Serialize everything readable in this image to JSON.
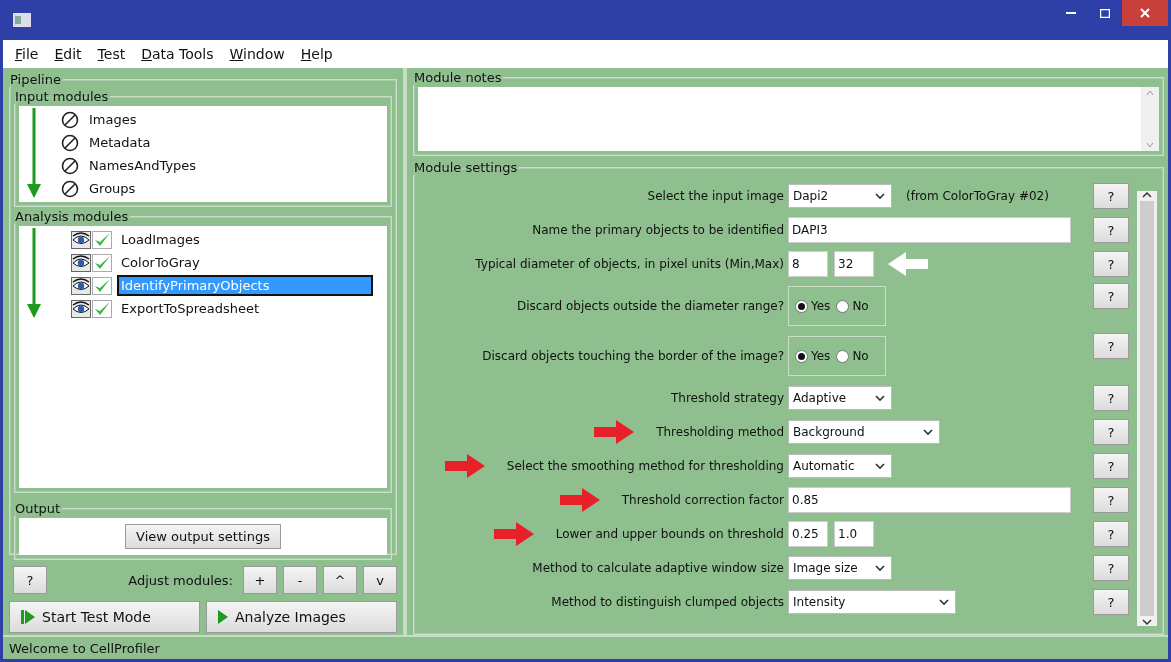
{
  "menu": [
    "File",
    "Edit",
    "Test",
    "Data Tools",
    "Window",
    "Help"
  ],
  "pipeline": {
    "title": "Pipeline",
    "input_modules": {
      "title": "Input modules",
      "items": [
        {
          "name": "Images"
        },
        {
          "name": "Metadata"
        },
        {
          "name": "NamesAndTypes"
        },
        {
          "name": "Groups"
        }
      ]
    },
    "analysis_modules": {
      "title": "Analysis modules",
      "items": [
        {
          "name": "LoadImages",
          "selected": false
        },
        {
          "name": "ColorToGray",
          "selected": false
        },
        {
          "name": "IdentifyPrimaryObjects",
          "selected": true
        },
        {
          "name": "ExportToSpreadsheet",
          "selected": false
        }
      ]
    },
    "output": {
      "title": "Output",
      "button": "View output settings"
    },
    "help_button": "?",
    "adjust_label": "Adjust modules:",
    "adjust_buttons": [
      "+",
      "-",
      "^",
      "v"
    ],
    "run_buttons": [
      {
        "label": "Start Test Mode",
        "kind": "test"
      },
      {
        "label": "Analyze Images",
        "kind": "analyze"
      }
    ]
  },
  "module_notes": {
    "title": "Module notes"
  },
  "module_settings": {
    "title": "Module settings",
    "settings": [
      {
        "label": "Select the input image",
        "kind": "choice",
        "value": "Dapi2",
        "note": "(from ColorToGray #02)",
        "help": "?"
      },
      {
        "label": "Name the primary objects to be identified",
        "kind": "text",
        "value": "DAPI3",
        "help": "?"
      },
      {
        "label": "Typical diameter of objects, in pixel units (Min,Max)",
        "kind": "pair",
        "values": [
          "8",
          "32"
        ],
        "arrow": {
          "kind": "after"
        },
        "help": "?"
      },
      {
        "label": "Discard objects outside the diameter range?",
        "kind": "radio",
        "options": [
          {
            "label": "Yes",
            "selected": true
          },
          {
            "label": "No",
            "selected": false
          }
        ],
        "help": "?"
      },
      {
        "label": "Discard objects touching the border of the image?",
        "kind": "radio",
        "options": [
          {
            "label": "Yes",
            "selected": true
          },
          {
            "label": "No",
            "selected": false
          }
        ],
        "help": "?"
      },
      {
        "label": "Threshold strategy",
        "kind": "choice",
        "value": "Adaptive",
        "help": "?"
      },
      {
        "label": "Thresholding method",
        "kind": "choice",
        "value": "Background",
        "wide": true,
        "arrow": {
          "kind": "before"
        },
        "help": "?"
      },
      {
        "label": "Select the smoothing method for thresholding",
        "kind": "choice",
        "value": "Automatic",
        "arrow": {
          "kind": "before"
        },
        "help": "?"
      },
      {
        "label": "Threshold correction factor",
        "kind": "text",
        "value": "0.85",
        "arrow": {
          "kind": "before"
        },
        "help": "?"
      },
      {
        "label": "Lower and upper bounds on threshold",
        "kind": "pair",
        "values": [
          "0.25",
          "1.0"
        ],
        "arrow": {
          "kind": "before"
        },
        "help": "?"
      },
      {
        "label": "Method to calculate adaptive window size",
        "kind": "choice",
        "value": "Image size",
        "help": "?"
      },
      {
        "label": "Method to distinguish clumped objects",
        "kind": "choice",
        "value": "Intensity",
        "wide": true,
        "help": "?"
      }
    ]
  },
  "status_bar": "Welcome to CellProfiler"
}
